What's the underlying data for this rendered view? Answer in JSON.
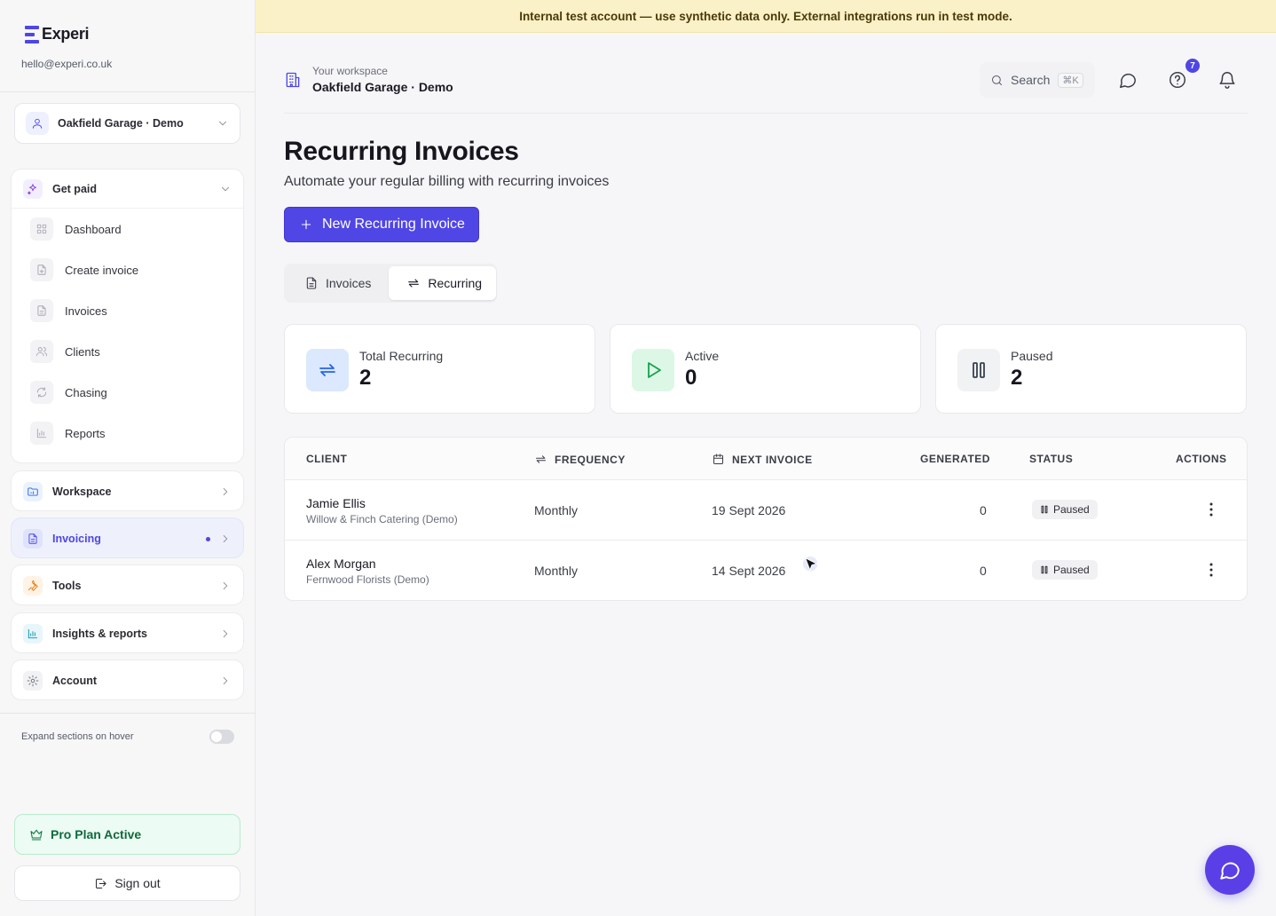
{
  "brand": {
    "name": "Experi",
    "email": "hello@experi.co.uk"
  },
  "workspace_select": {
    "name": "Oakfield Garage · Demo"
  },
  "sidebar": {
    "get_paid": {
      "label": "Get paid",
      "items": [
        {
          "label": "Dashboard"
        },
        {
          "label": "Create invoice"
        },
        {
          "label": "Invoices"
        },
        {
          "label": "Clients"
        },
        {
          "label": "Chasing"
        },
        {
          "label": "Reports"
        }
      ]
    },
    "sections": [
      {
        "label": "Workspace"
      },
      {
        "label": "Invoicing"
      },
      {
        "label": "Tools"
      },
      {
        "label": "Insights & reports"
      },
      {
        "label": "Account"
      }
    ],
    "expand_hover_label": "Expand sections on hover",
    "pro_plan_label": "Pro Plan Active",
    "sign_out_label": "Sign out"
  },
  "banner": {
    "text": "Internal test account — use synthetic data only. External integrations run in test mode."
  },
  "header": {
    "caption": "Your workspace",
    "workspace": "Oakfield Garage · Demo",
    "search_label": "Search",
    "search_shortcut": "⌘K",
    "help_badge": "7"
  },
  "page": {
    "title": "Recurring Invoices",
    "subtitle": "Automate your regular billing with recurring invoices",
    "new_button": "New Recurring Invoice"
  },
  "tabs": [
    {
      "label": "Invoices"
    },
    {
      "label": "Recurring"
    }
  ],
  "stats": [
    {
      "label": "Total Recurring",
      "value": "2",
      "color": "#2563eb"
    },
    {
      "label": "Active",
      "value": "0",
      "color": "#16a34a"
    },
    {
      "label": "Paused",
      "value": "2",
      "color": "#4b5563"
    }
  ],
  "table": {
    "headers": {
      "client": "CLIENT",
      "frequency": "FREQUENCY",
      "next_invoice": "NEXT INVOICE",
      "generated": "GENERATED",
      "status": "STATUS",
      "actions": "ACTIONS"
    },
    "rows": [
      {
        "client": "Jamie Ellis",
        "org": "Willow & Finch Catering (Demo)",
        "frequency": "Monthly",
        "next_invoice": "19 Sept 2026",
        "generated": "0",
        "status": "Paused"
      },
      {
        "client": "Alex Morgan",
        "org": "Fernwood Florists (Demo)",
        "frequency": "Monthly",
        "next_invoice": "14 Sept 2026",
        "generated": "0",
        "status": "Paused"
      }
    ]
  },
  "colors": {
    "accent": "#4f46e5",
    "banner": "#fbf1c8",
    "pro_plan": "#ecfbf3"
  }
}
